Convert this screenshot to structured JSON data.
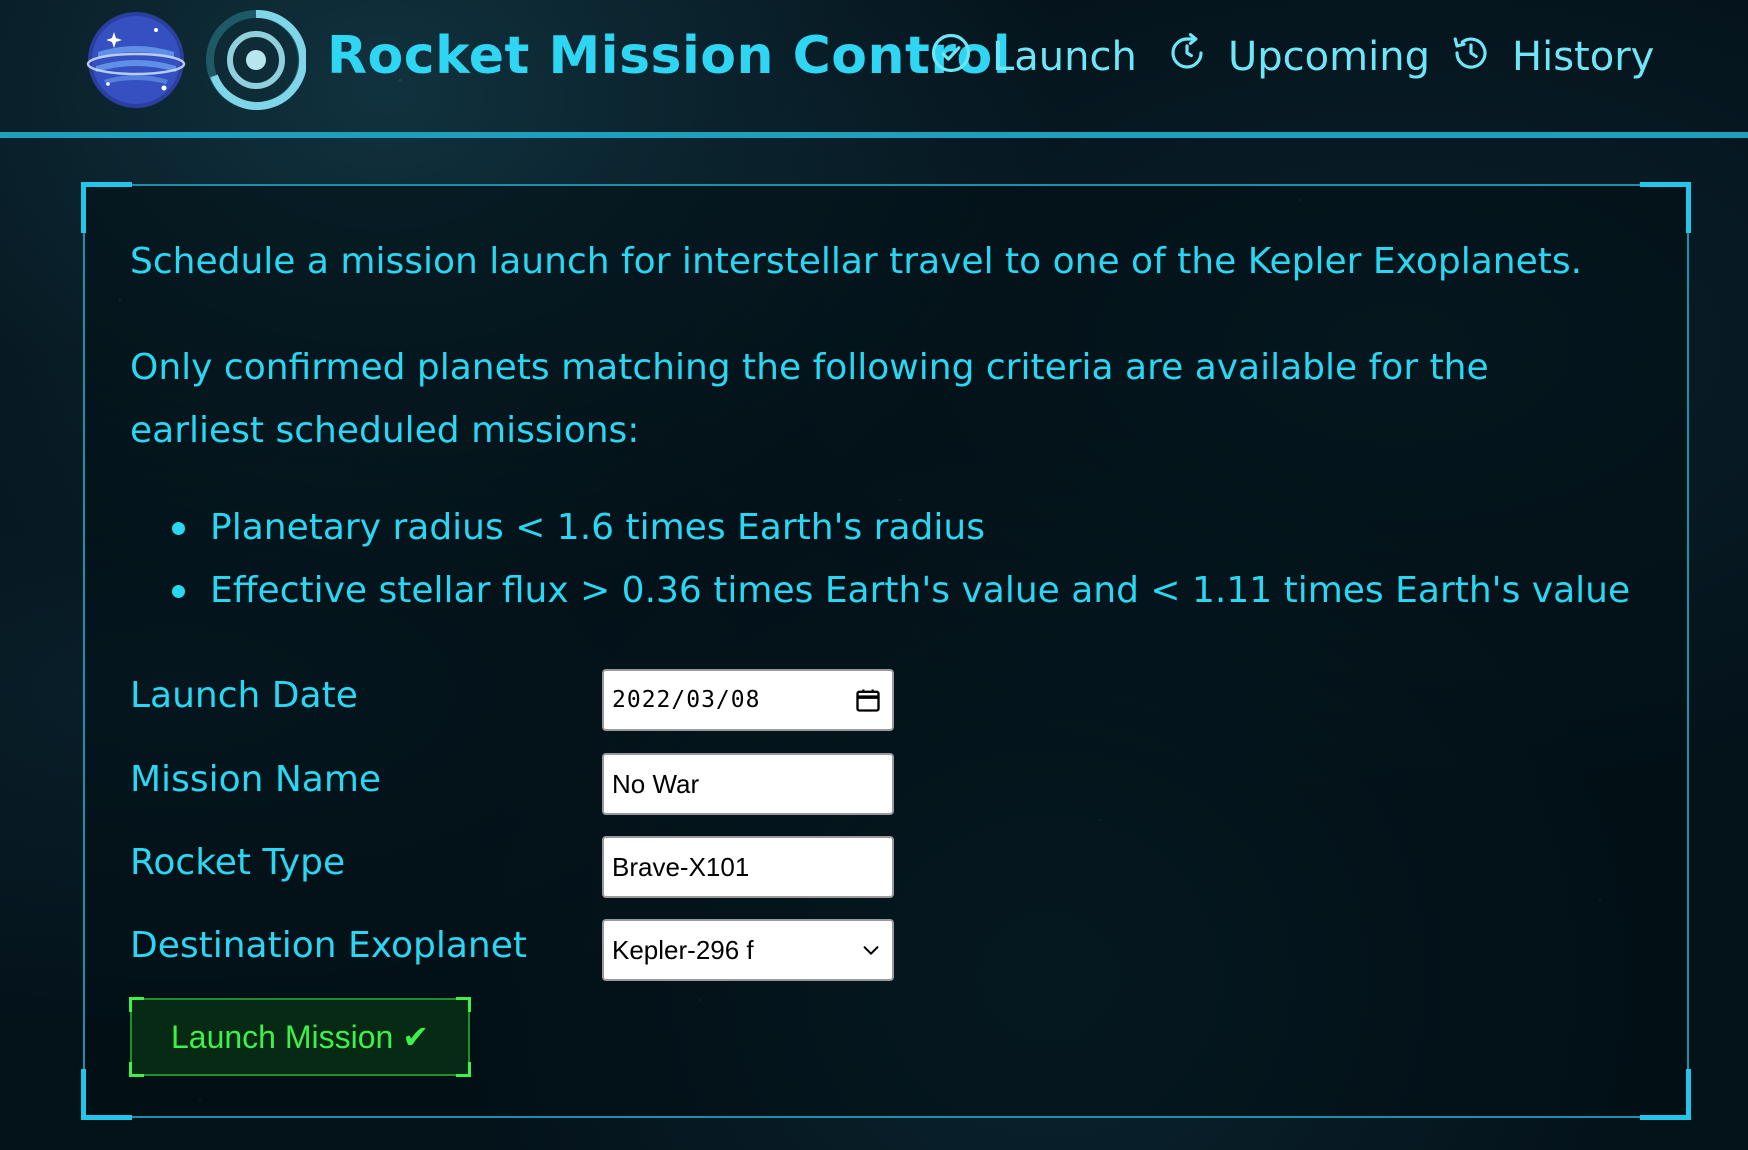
{
  "header": {
    "title": "Rocket Mission Control",
    "nav": [
      {
        "label": "Launch",
        "icon": "check-circle-icon"
      },
      {
        "label": "Upcoming",
        "icon": "refresh-icon"
      },
      {
        "label": "History",
        "icon": "history-icon"
      }
    ]
  },
  "content": {
    "intro": "Schedule a mission launch for interstellar travel to one of the Kepler Exoplanets.",
    "criteria_intro": "Only confirmed planets matching the following criteria are available for the earliest scheduled missions:",
    "criteria": [
      "Planetary radius < 1.6 times Earth's radius",
      "Effective stellar flux > 0.36 times Earth's value and < 1.11 times Earth's value"
    ]
  },
  "form": {
    "launch_date": {
      "label": "Launch Date",
      "value": "2022/03/08"
    },
    "mission_name": {
      "label": "Mission Name",
      "value": "No War"
    },
    "rocket_type": {
      "label": "Rocket Type",
      "value": "Brave-X101"
    },
    "destination": {
      "label": "Destination Exoplanet",
      "value": "Kepler-296 f"
    },
    "submit_label": "Launch Mission ✔"
  },
  "colors": {
    "accent": "#2ad7f2",
    "frame": "#1a8fae",
    "button_text": "#3df04b",
    "background": "#04121a"
  }
}
